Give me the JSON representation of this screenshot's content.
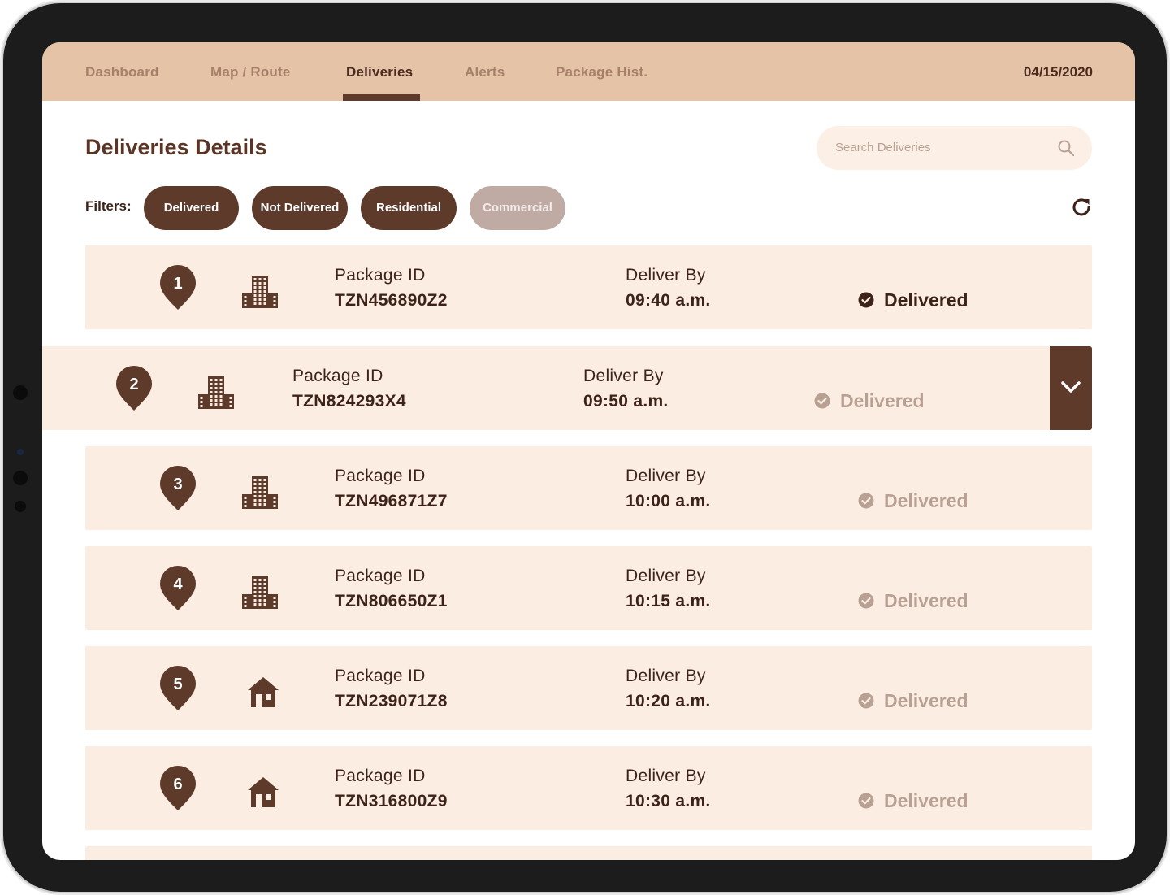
{
  "nav": {
    "tabs": [
      {
        "label": "Dashboard"
      },
      {
        "label": "Map / Route"
      },
      {
        "label": "Deliveries"
      },
      {
        "label": "Alerts"
      },
      {
        "label": "Package Hist."
      }
    ],
    "date": "04/15/2020"
  },
  "page": {
    "title": "Deliveries Details",
    "search_placeholder": "Search Deliveries"
  },
  "filters": {
    "label": "Filters:",
    "chips": [
      {
        "label": "Delivered",
        "active": true
      },
      {
        "label": "Not Delivered",
        "active": true
      },
      {
        "label": "Residential",
        "active": true
      },
      {
        "label": "Commercial",
        "active": false
      }
    ]
  },
  "deliveries": [
    {
      "stop": "1",
      "type": "commercial",
      "package_label": "Package ID",
      "package_id": "TZN456890Z2",
      "deliver_label": "Deliver By",
      "deliver_by": "09:40 a.m.",
      "status": "Delivered"
    },
    {
      "stop": "2",
      "type": "commercial",
      "package_label": "Package ID",
      "package_id": "TZN824293X4",
      "deliver_label": "Deliver By",
      "deliver_by": "09:50 a.m.",
      "status": "Delivered"
    },
    {
      "stop": "3",
      "type": "commercial",
      "package_label": "Package ID",
      "package_id": "TZN496871Z7",
      "deliver_label": "Deliver By",
      "deliver_by": "10:00 a.m.",
      "status": "Delivered"
    },
    {
      "stop": "4",
      "type": "commercial",
      "package_label": "Package ID",
      "package_id": "TZN806650Z1",
      "deliver_label": "Deliver By",
      "deliver_by": "10:15 a.m.",
      "status": "Delivered"
    },
    {
      "stop": "5",
      "type": "residential",
      "package_label": "Package ID",
      "package_id": "TZN239071Z8",
      "deliver_label": "Deliver By",
      "deliver_by": "10:20 a.m.",
      "status": "Delivered"
    },
    {
      "stop": "6",
      "type": "residential",
      "package_label": "Package ID",
      "package_id": "TZN316800Z9",
      "deliver_label": "Deliver By",
      "deliver_by": "10:30 a.m.",
      "status": "Delivered"
    }
  ],
  "colors": {
    "nav_bg": "#e5c3a7",
    "accent_dark": "#5e3a2b",
    "row_bg": "#fcede3",
    "muted": "#b8a193"
  }
}
